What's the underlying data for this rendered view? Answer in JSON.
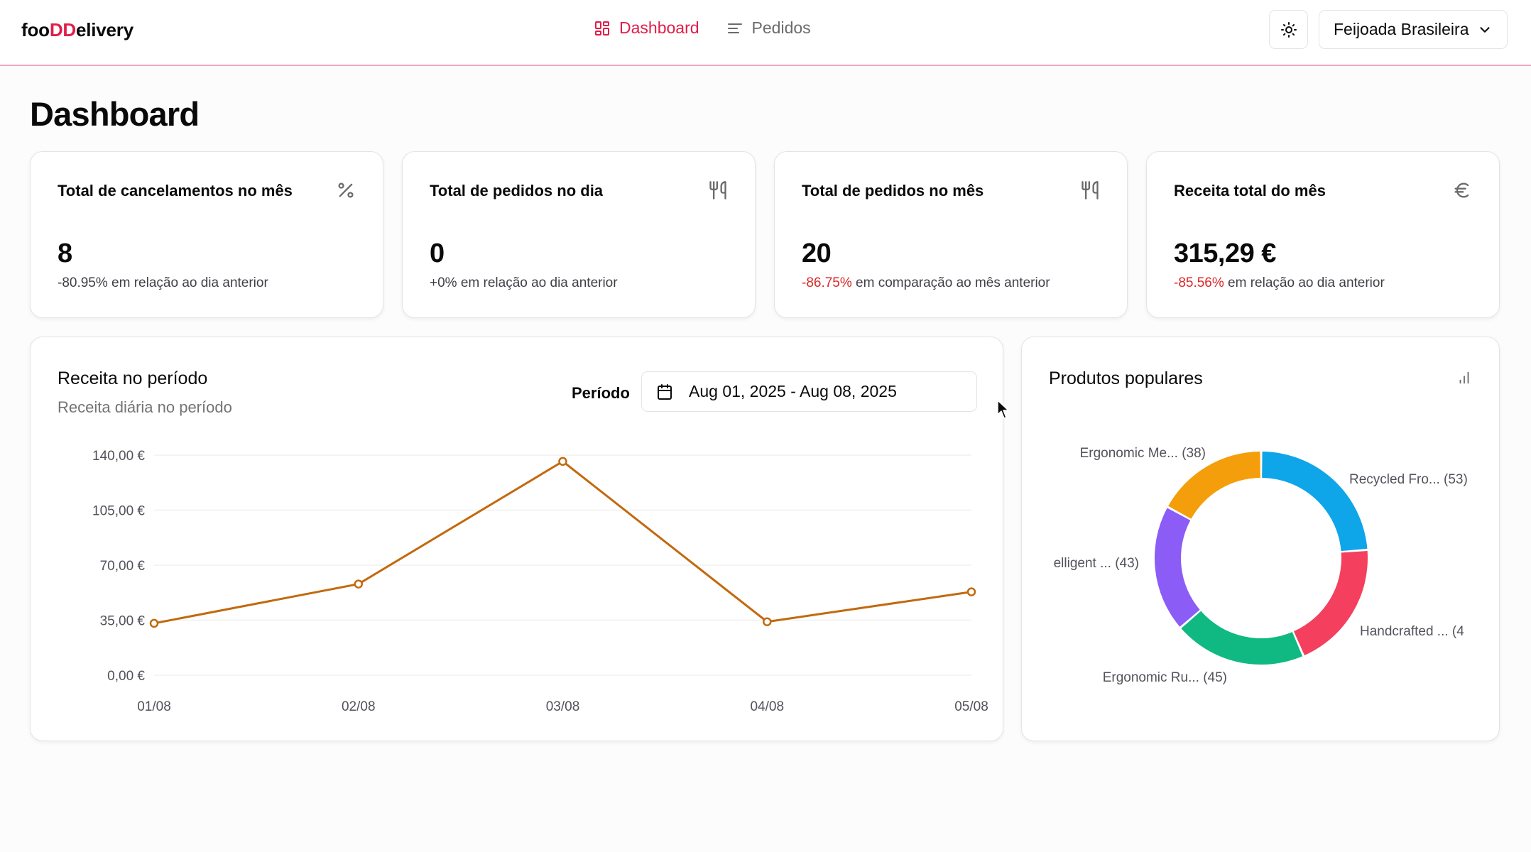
{
  "header": {
    "logo_part1": "foo",
    "logo_part2": "DD",
    "logo_part3": "elivery",
    "nav": [
      {
        "label": "Dashboard",
        "icon": "layout-grid-icon",
        "active": true
      },
      {
        "label": "Pedidos",
        "icon": "list-icon",
        "active": false
      }
    ],
    "theme_icon": "sun-icon",
    "store_name": "Feijoada Brasileira"
  },
  "page": {
    "title": "Dashboard"
  },
  "stats": [
    {
      "title": "Total de cancelamentos no mês",
      "icon": "percent-icon",
      "value": "8",
      "change": "-80.95%",
      "change_color": "#3f3f46",
      "suffix": " em relação ao dia anterior"
    },
    {
      "title": "Total de pedidos no dia",
      "icon": "utensils-icon",
      "value": "0",
      "change": "+0%",
      "change_color": "#3f3f46",
      "suffix": " em relação ao dia anterior"
    },
    {
      "title": "Total de pedidos no mês",
      "icon": "utensils-icon",
      "value": "20",
      "change": "-86.75%",
      "change_color": "#dc2626",
      "suffix": " em comparação ao mês anterior"
    },
    {
      "title": "Receita total do mês",
      "icon": "euro-icon",
      "value": "315,29 €",
      "change": "-85.56%",
      "change_color": "#dc2626",
      "suffix": " em relação ao dia anterior"
    }
  ],
  "revenue": {
    "title": "Receita no período",
    "subtitle": "Receita diária no período",
    "period_label": "Período",
    "date_range": "Aug 01, 2025 - Aug 08, 2025"
  },
  "popular": {
    "title": "Produtos populares",
    "icon": "bar-chart-icon"
  },
  "colors": {
    "accent": "#e11d48",
    "line": "#c2690e"
  },
  "chart_data": [
    {
      "type": "line",
      "x": [
        "01/08",
        "02/08",
        "03/08",
        "04/08",
        "05/08"
      ],
      "series": [
        {
          "values": [
            33,
            58,
            136,
            34,
            53
          ]
        }
      ],
      "ylim": [
        0,
        140
      ],
      "yticks": [
        "0,00 €",
        "35,00 €",
        "70,00 €",
        "105,00 €",
        "140,00 €"
      ],
      "ytick_values": [
        0,
        35,
        70,
        105,
        140
      ],
      "grid": true
    },
    {
      "type": "pie",
      "donut": true,
      "labels": [
        "Recycled Fro... (53)",
        "Handcrafted ... (4",
        "Ergonomic Ru... (45)",
        "elligent ... (43)",
        "Ergonomic Me... (38)"
      ],
      "values": [
        53,
        44,
        45,
        43,
        38
      ],
      "colors": [
        "#0ea5e9",
        "#f43f5e",
        "#10b981",
        "#8b5cf6",
        "#f59e0b"
      ]
    }
  ]
}
